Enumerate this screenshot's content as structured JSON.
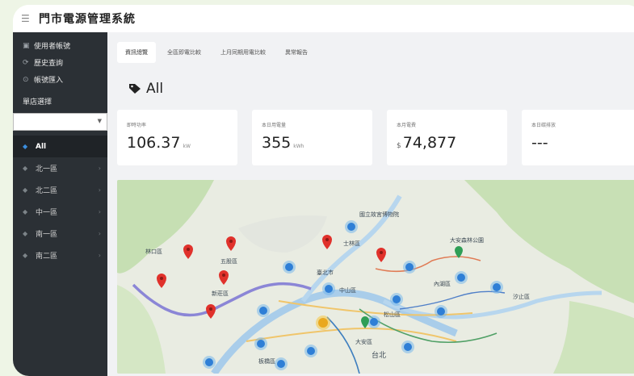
{
  "app": {
    "title": "門市電源管理系統"
  },
  "sidebar": {
    "items": [
      {
        "label": "使用者帳號",
        "icon": "user-icon"
      },
      {
        "label": "歷史查詢",
        "icon": "history-icon"
      },
      {
        "label": "帳號匯入",
        "icon": "import-icon"
      }
    ],
    "store_heading": "單店選擇",
    "select_value": "",
    "tree": [
      {
        "label": "All",
        "icon": "tag-icon",
        "active": true
      },
      {
        "label": "北一區",
        "icon": "tag-icon"
      },
      {
        "label": "北二區",
        "icon": "tag-icon"
      },
      {
        "label": "中一區",
        "icon": "tag-icon"
      },
      {
        "label": "南一區",
        "icon": "tag-icon"
      },
      {
        "label": "南二區",
        "icon": "tag-icon"
      }
    ]
  },
  "tabs": [
    "資訊總覽",
    "全區即電比較",
    "上月同期用電比較",
    "異常報告"
  ],
  "heading": "All",
  "kpis": [
    {
      "label": "即時功率",
      "prefix": "",
      "value": "106.37",
      "unit": "kW"
    },
    {
      "label": "本日用電量",
      "prefix": "",
      "value": "355",
      "unit": "kWh"
    },
    {
      "label": "本月電費",
      "prefix": "$",
      "value": "74,877",
      "unit": ""
    },
    {
      "label": "本日碳排放",
      "prefix": "",
      "value": "---",
      "unit": ""
    }
  ],
  "map": {
    "labels": [
      "五股區",
      "林口區",
      "新莊區",
      "臺北市",
      "中山區",
      "松山區",
      "內湖區",
      "汐止區",
      "士林區",
      "台北",
      "大安區",
      "板橋區",
      "國立故宮博物院",
      "大安森林公園"
    ]
  }
}
